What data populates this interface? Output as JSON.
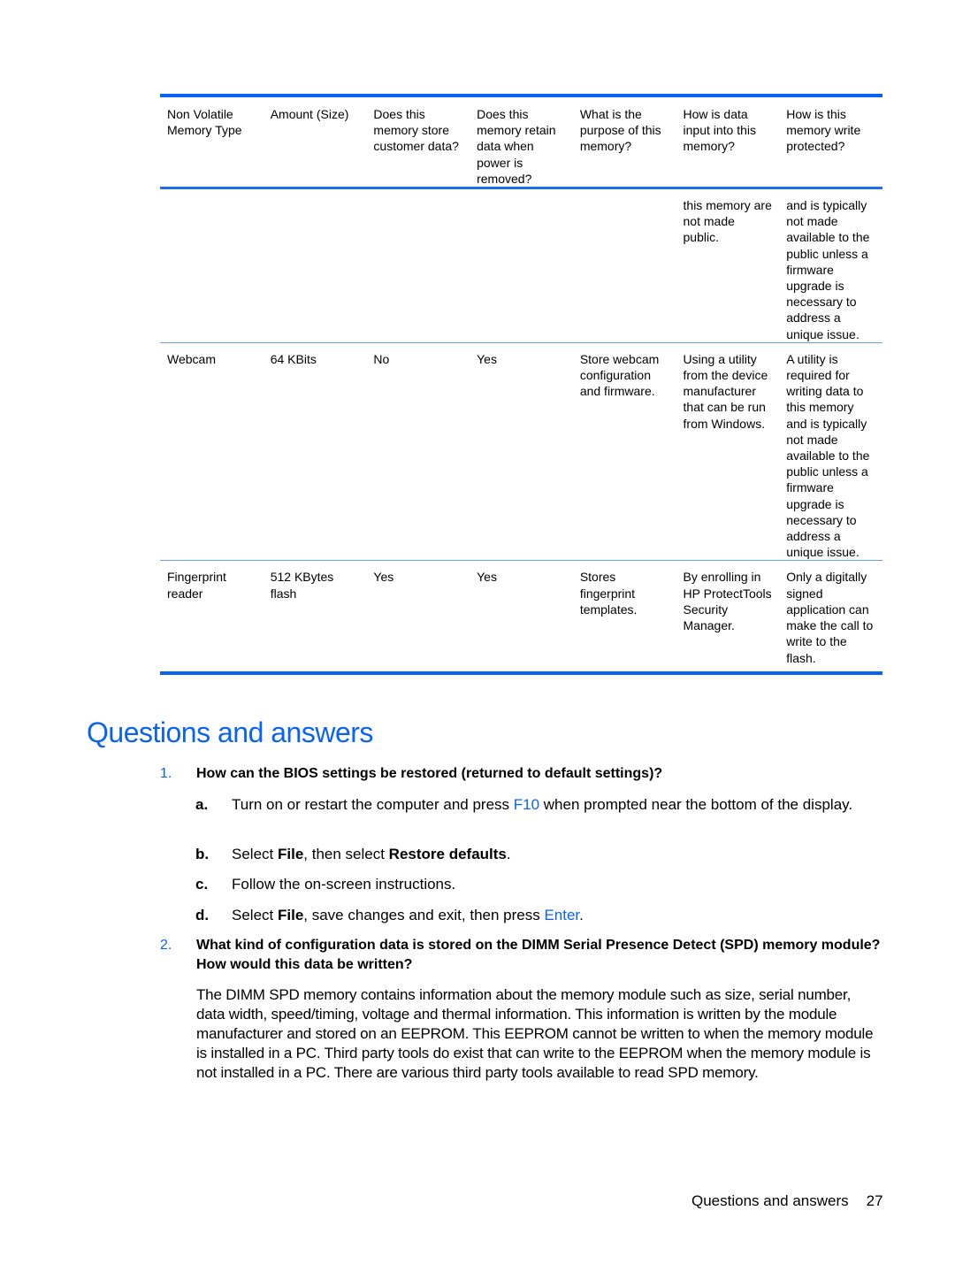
{
  "table": {
    "headers": [
      "Non Volatile Memory Type",
      "Amount (Size)",
      "Does this memory store customer data?",
      "Does this memory retain data when power is removed?",
      "What is the purpose of this memory?",
      "How is data input into this memory?",
      "How is this memory write protected?"
    ],
    "rows": [
      [
        "",
        "",
        "",
        "",
        "",
        "this memory are not made public.",
        "and is typically not made available to the public unless a firmware upgrade is necessary to address a unique issue."
      ],
      [
        "Webcam",
        "64 KBits",
        "No",
        "Yes",
        "Store webcam configuration and firmware.",
        "Using a utility from the device manufacturer that can be run from Windows.",
        "A utility is required for writing data to this memory and is typically not made available to the public unless a firmware upgrade is necessary to address a unique issue."
      ],
      [
        "Fingerprint reader",
        "512 KBytes flash",
        "Yes",
        "Yes",
        "Stores fingerprint templates.",
        "By enrolling in HP ProtectTools Security Manager.",
        "Only a digitally signed application can make the call to write to the flash."
      ]
    ]
  },
  "section": {
    "title": "Questions and answers",
    "questions": [
      {
        "number": "1.",
        "text": "How can the BIOS settings be restored (returned to default settings)?",
        "steps": [
          {
            "letter": "a.",
            "parts": [
              "Turn on or restart the computer and press ",
              "F10",
              " when prompted near the bottom of the display."
            ]
          },
          {
            "letter": "b.",
            "parts": [
              "Select ",
              "File",
              ", then select ",
              "Restore defaults",
              "."
            ]
          },
          {
            "letter": "c.",
            "parts": [
              "Follow the on-screen instructions."
            ]
          },
          {
            "letter": "d.",
            "parts": [
              "Select ",
              "File",
              ", save changes and exit, then press ",
              "Enter",
              "."
            ]
          }
        ]
      },
      {
        "number": "2.",
        "text": "What kind of configuration data is stored on the DIMM Serial Presence Detect (SPD) memory module? How would this data be written?",
        "answer": "The DIMM SPD memory contains information about the memory module such as size, serial number, data width, speed/timing, voltage and thermal information. This information is written by the module manufacturer and stored on an EEPROM. This EEPROM cannot be written to when the memory module is installed in a PC. Third party tools do exist that can write to the EEPROM when the memory module is not installed in a PC. There are various third party tools available to read SPD memory."
      }
    ]
  },
  "footer": {
    "section_name": "Questions and answers",
    "page_number": "27"
  },
  "colors": {
    "accent": "#0a63f0",
    "row_separator": "#6a9ef2"
  }
}
